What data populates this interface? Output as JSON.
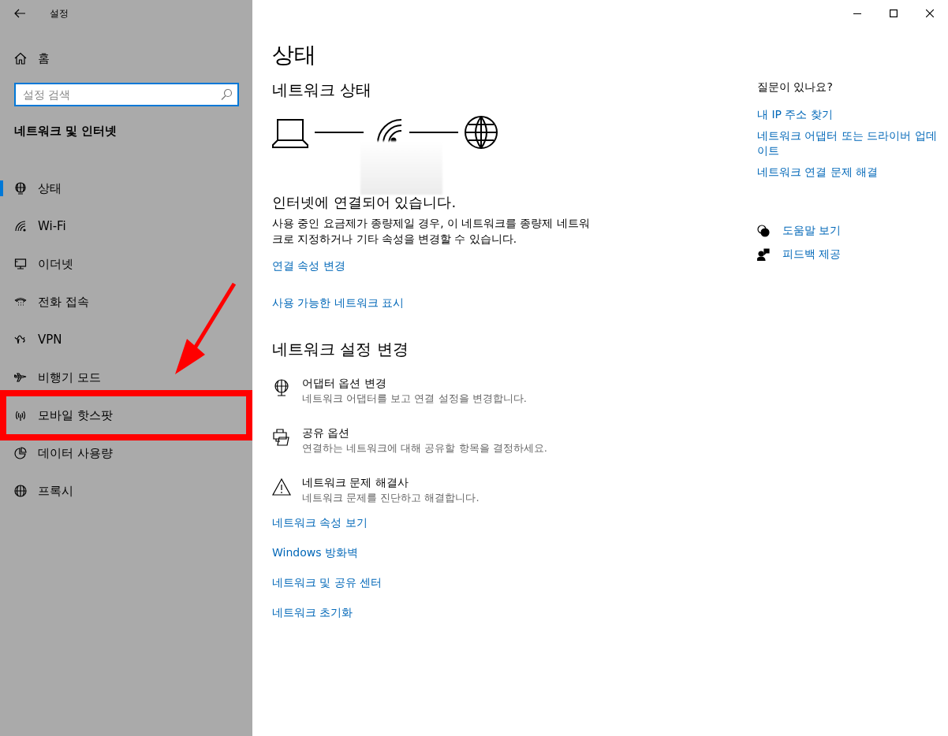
{
  "window": {
    "title": "설정"
  },
  "sidebar": {
    "home": "홈",
    "search": {
      "placeholder": "설정 검색"
    },
    "section_title": "네트워크 및 인터넷",
    "items": [
      {
        "label": "상태",
        "selected": true,
        "highlighted": false
      },
      {
        "label": "Wi-Fi",
        "selected": false,
        "highlighted": false
      },
      {
        "label": "이더넷",
        "selected": false,
        "highlighted": false
      },
      {
        "label": "전화 접속",
        "selected": false,
        "highlighted": false
      },
      {
        "label": "VPN",
        "selected": false,
        "highlighted": false
      },
      {
        "label": "비행기 모드",
        "selected": false,
        "highlighted": false
      },
      {
        "label": "모바일 핫스팟",
        "selected": false,
        "highlighted": true
      },
      {
        "label": "데이터 사용량",
        "selected": false,
        "highlighted": false
      },
      {
        "label": "프록시",
        "selected": false,
        "highlighted": false
      }
    ]
  },
  "main": {
    "title": "상태",
    "network_status": {
      "heading": "네트워크 상태",
      "status_text": "인터넷에 연결되어 있습니다.",
      "description": "사용 중인 요금제가 종량제일 경우, 이 네트워크를 종량제 네트워크로 지정하거나 기타 속성을 변경할 수 있습니다.",
      "links": [
        "연결 속성 변경",
        "사용 가능한 네트워크 표시"
      ]
    },
    "settings": {
      "heading": "네트워크 설정 변경",
      "options": [
        {
          "title": "어댑터 옵션 변경",
          "description": "네트워크 어댑터를 보고 연결 설정을 변경합니다."
        },
        {
          "title": "공유 옵션",
          "description": "연결하는 네트워크에 대해 공유할 항목을 결정하세요."
        },
        {
          "title": "네트워크 문제 해결사",
          "description": "네트워크 문제를 진단하고 해결합니다."
        }
      ],
      "links": [
        "네트워크 속성 보기",
        "Windows 방화벽",
        "네트워크 및 공유 센터",
        "네트워크 초기화"
      ]
    }
  },
  "aside": {
    "heading": "질문이 있나요?",
    "links": [
      "내 IP 주소 찾기",
      "네트워크 어댑터 또는 드라이버 업데이트",
      "네트워크 연결 문제 해결"
    ],
    "support": [
      "도움말 보기",
      "피드백 제공"
    ]
  }
}
